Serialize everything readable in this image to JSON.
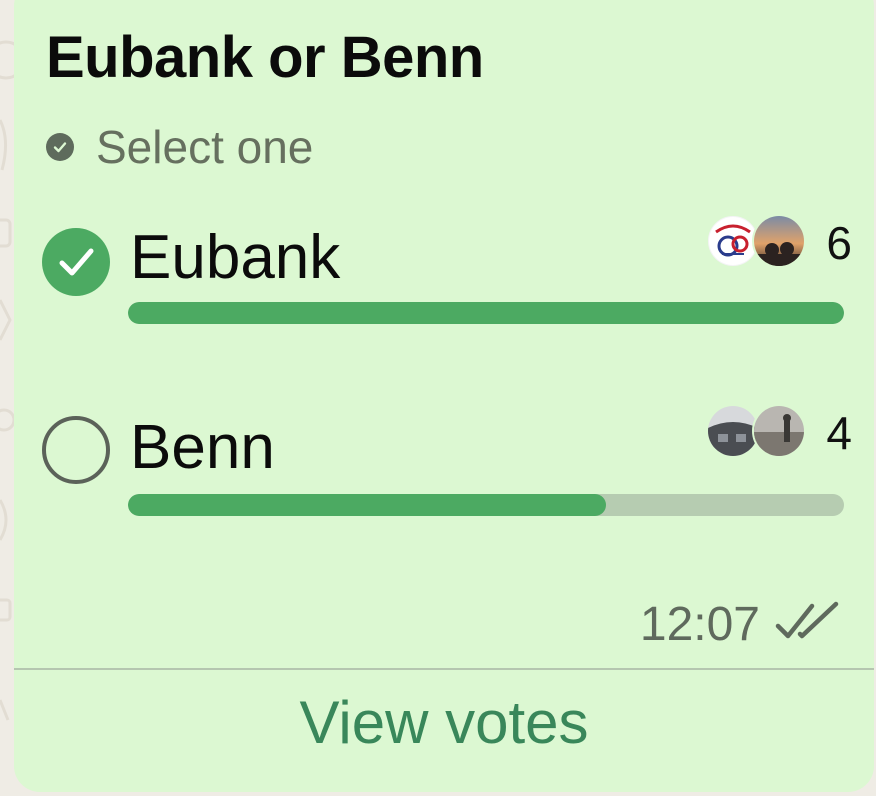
{
  "poll": {
    "title": "Eubank or Benn",
    "instruction": "Select one",
    "instruction_icon": "check-circle-icon",
    "options": [
      {
        "label": "Eubank",
        "votes": "6",
        "vote_fraction": 1.0,
        "selected": true,
        "voter_avatars": [
          "logo-avatar",
          "sunset-photo-avatar"
        ]
      },
      {
        "label": "Benn",
        "votes": "4",
        "vote_fraction": 0.667,
        "selected": false,
        "voter_avatars": [
          "cockpit-photo-avatar",
          "beach-photo-avatar"
        ]
      }
    ],
    "timestamp": "12:07",
    "status_icon": "double-check-read-icon",
    "view_votes_label": "View votes"
  },
  "colors": {
    "bubble": "#dcf8d2",
    "accent_green": "#4caa62",
    "bar_track": "#b6ccb1",
    "link_green": "#39875a",
    "muted_text": "#66705f"
  }
}
